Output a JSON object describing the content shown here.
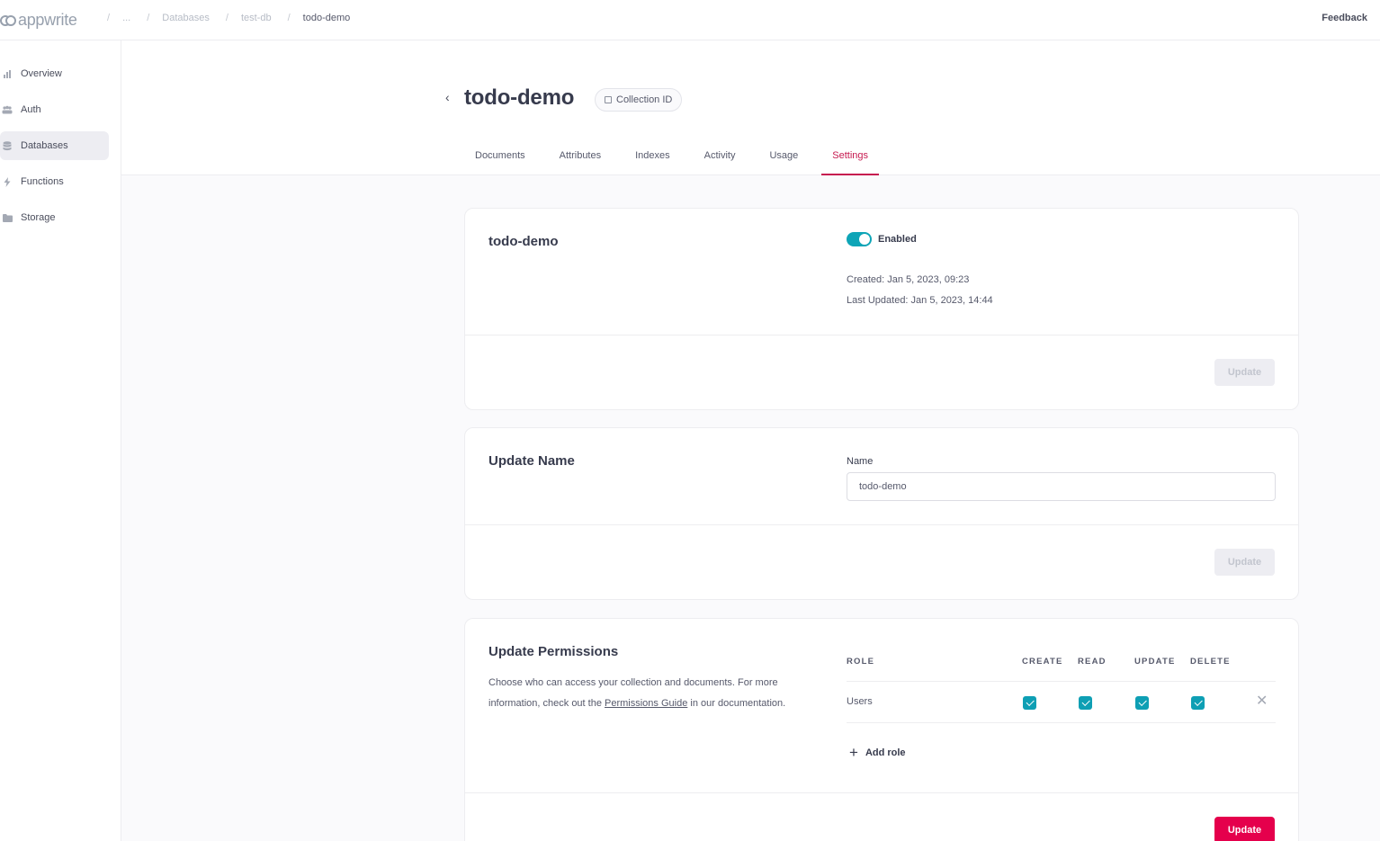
{
  "app": {
    "logo_text": "appwrite"
  },
  "breadcrumb": {
    "separator": "/",
    "items": [
      "...",
      "Databases",
      "test-db",
      "todo-demo"
    ]
  },
  "header": {
    "feedback_label": "Feedback"
  },
  "sidebar": {
    "items": [
      {
        "label": "Overview",
        "icon": "chart-bar-icon"
      },
      {
        "label": "Auth",
        "icon": "users-icon"
      },
      {
        "label": "Databases",
        "icon": "database-icon",
        "active": true
      },
      {
        "label": "Functions",
        "icon": "lightning-icon"
      },
      {
        "label": "Storage",
        "icon": "folder-icon"
      }
    ]
  },
  "page": {
    "title": "todo-demo",
    "collection_id_label": "Collection ID",
    "tabs": [
      "Documents",
      "Attributes",
      "Indexes",
      "Activity",
      "Usage",
      "Settings"
    ],
    "active_tab": "Settings"
  },
  "status_card": {
    "title": "todo-demo",
    "toggle_label": "Enabled",
    "enabled": true,
    "created": "Created: Jan 5, 2023, 09:23",
    "last_updated": "Last Updated: Jan 5, 2023, 14:44",
    "update_label": "Update"
  },
  "name_card": {
    "title": "Update Name",
    "field_label": "Name",
    "field_value": "todo-demo",
    "update_label": "Update"
  },
  "permissions_card": {
    "title": "Update Permissions",
    "desc_before": "Choose who can access your collection and documents. For more information, check out the ",
    "desc_link": "Permissions Guide",
    "desc_after": " in our documentation.",
    "columns": [
      "ROLE",
      "CREATE",
      "READ",
      "UPDATE",
      "DELETE"
    ],
    "rows": [
      {
        "role": "Users",
        "create": true,
        "read": true,
        "update": true,
        "delete": true
      }
    ],
    "add_role_label": "Add role",
    "update_label": "Update"
  },
  "colors": {
    "accent": "#c6194f",
    "primary_button": "#e5004c",
    "toggle_on": "#0ea5b7",
    "checkbox": "#0e9fb4"
  }
}
